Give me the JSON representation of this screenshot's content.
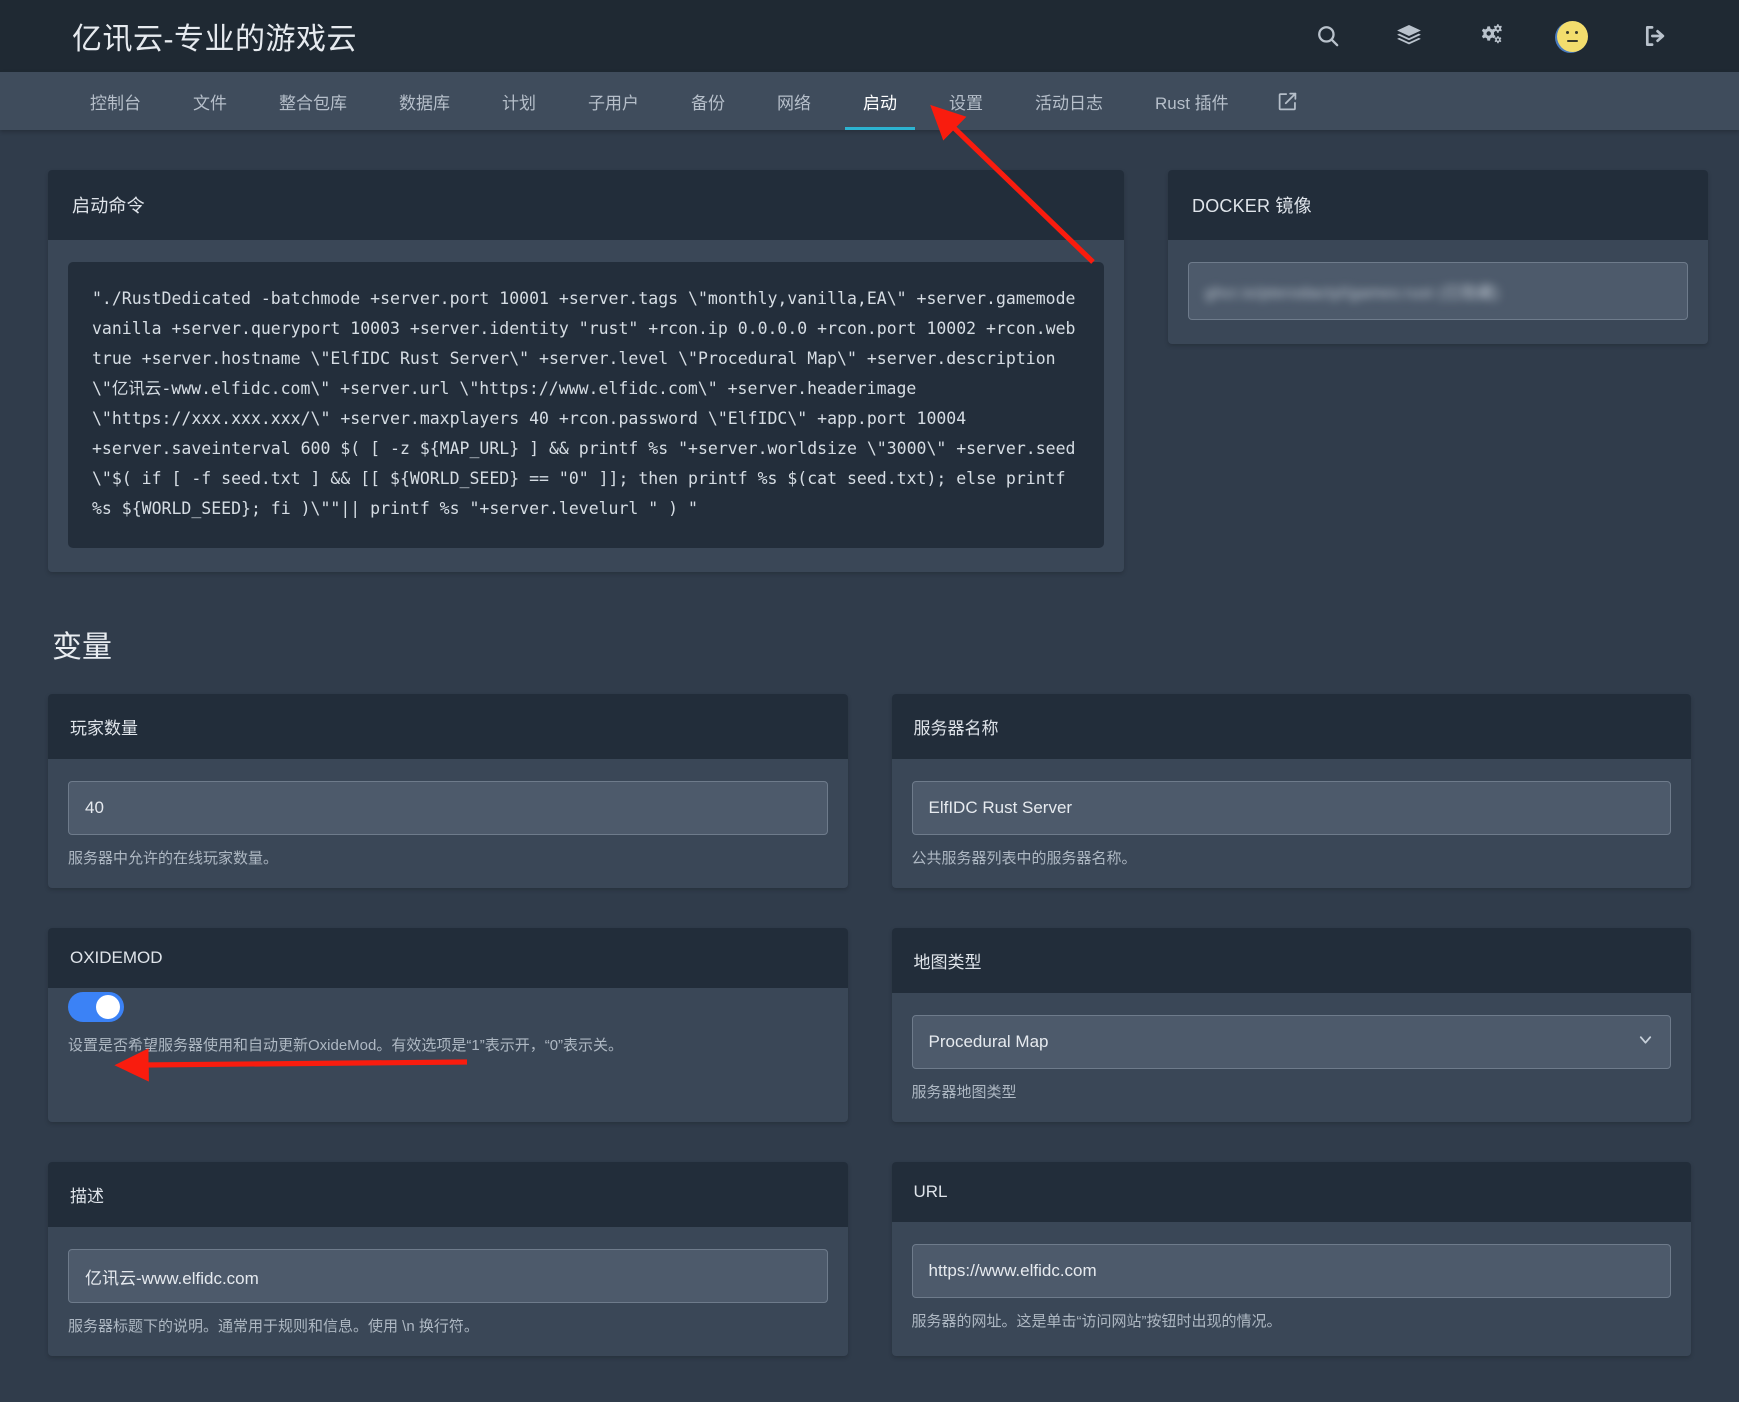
{
  "header": {
    "brand": "亿讯云-专业的游戏云",
    "icons": [
      {
        "name": "search-icon",
        "label": "搜索"
      },
      {
        "name": "layers-icon",
        "label": "服务器列表"
      },
      {
        "name": "gears-icon",
        "label": "管理设置"
      },
      {
        "name": "avatar",
        "label": "用户头像"
      },
      {
        "name": "logout-icon",
        "label": "退出登录"
      }
    ]
  },
  "nav": {
    "tabs": [
      {
        "label": "控制台",
        "active": false
      },
      {
        "label": "文件",
        "active": false
      },
      {
        "label": "整合包库",
        "active": false
      },
      {
        "label": "数据库",
        "active": false
      },
      {
        "label": "计划",
        "active": false
      },
      {
        "label": "子用户",
        "active": false
      },
      {
        "label": "备份",
        "active": false
      },
      {
        "label": "网络",
        "active": false
      },
      {
        "label": "启动",
        "active": true
      },
      {
        "label": "设置",
        "active": false
      },
      {
        "label": "活动日志",
        "active": false
      },
      {
        "label": "Rust 插件",
        "active": false
      }
    ],
    "external_link_icon": "external-link-icon",
    "active_indicator_color": "#2cb3d1"
  },
  "startup_command": {
    "title": "启动命令",
    "command": "\"./RustDedicated -batchmode +server.port 10001 +server.tags \\\"monthly,vanilla,EA\\\" +server.gamemode vanilla +server.queryport 10003 +server.identity \"rust\" +rcon.ip 0.0.0.0 +rcon.port 10002 +rcon.web true +server.hostname \\\"ElfIDC Rust Server\\\" +server.level \\\"Procedural Map\\\" +server.description \\\"亿讯云-www.elfidc.com\\\" +server.url \\\"https://www.elfidc.com\\\" +server.headerimage \\\"https://xxx.xxx.xxx/\\\" +server.maxplayers 40 +rcon.password \\\"ElfIDC\\\" +app.port 10004 +server.saveinterval 600 $( [ -z ${MAP_URL} ] && printf %s \"+server.worldsize \\\"3000\\\" +server.seed \\\"$( if [ -f seed.txt ] && [[ ${WORLD_SEED} == \"0\" ]]; then printf %s $(cat seed.txt); else printf %s ${WORLD_SEED}; fi )\\\"\"|| printf %s \"+server.levelurl \" ) \""
  },
  "docker_image": {
    "title": "DOCKER 镜像",
    "value": "ghcr.io/pterodactyl/games:rust  (已隐藏)",
    "redacted": true
  },
  "variables_section_title": "变量",
  "variables": [
    {
      "title": "玩家数量",
      "type": "text",
      "value": "40",
      "hint": "服务器中允许的在线玩家数量。"
    },
    {
      "title": "服务器名称",
      "type": "text",
      "value": "ElfIDC Rust Server",
      "hint": "公共服务器列表中的服务器名称。"
    },
    {
      "title": "OXIDEMOD",
      "type": "toggle",
      "value": "on",
      "hint": "设置是否希望服务器使用和自动更新OxideMod。有效选项是“1”表示开，“0”表示关。"
    },
    {
      "title": "地图类型",
      "type": "select",
      "value": "Procedural Map",
      "hint": "服务器地图类型"
    },
    {
      "title": "描述",
      "type": "text",
      "value": "亿讯云-www.elfidc.com",
      "hint": "服务器标题下的说明。通常用于规则和信息。使用 \\n 换行符。"
    },
    {
      "title": "URL",
      "type": "text",
      "value": "https://www.elfidc.com",
      "hint": "服务器的网址。这是单击“访问网站”按钮时出现的情况。"
    }
  ],
  "annotations": {
    "arrow_color": "#f91c0e",
    "arrows": [
      {
        "name": "arrow-to-startup-tab"
      },
      {
        "name": "arrow-to-oxidemod-toggle"
      }
    ]
  },
  "theme": {
    "page_bg": "#303c4b",
    "topbar_bg": "#1f2933",
    "nav_bg": "#3f4c5c",
    "card_bg": "#3a4757",
    "card_head_bg": "#222d3a",
    "code_bg": "#232e3b",
    "input_bg": "#4d5a6b",
    "accent": "#2cb3d1",
    "toggle_on": "#3b82f6"
  }
}
